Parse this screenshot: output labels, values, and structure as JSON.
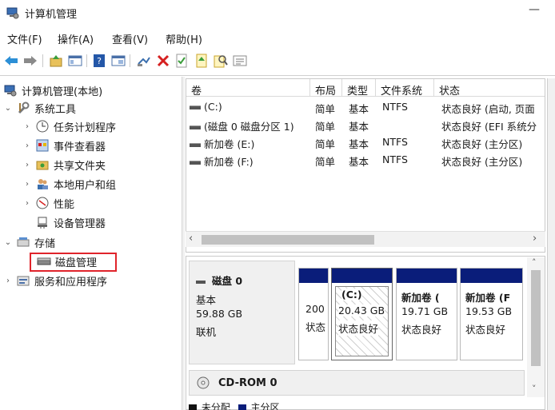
{
  "window": {
    "title": "计算机管理",
    "minimize_glyph": "—"
  },
  "menu": [
    {
      "label": "文件(F)"
    },
    {
      "label": "操作(A)"
    },
    {
      "label": "查看(V)"
    },
    {
      "label": "帮助(H)"
    }
  ],
  "toolbar": {
    "icons": [
      "back-arrow-icon",
      "forward-arrow-icon",
      "up-folder-icon",
      "show-tree-icon",
      "help-icon",
      "console-icon",
      "connect-icon",
      "delete-icon",
      "properties-icon",
      "import-icon",
      "search-icon",
      "settings-list-icon"
    ]
  },
  "tree": {
    "root": "计算机管理(本地)",
    "system_tools": "系统工具",
    "task_scheduler": "任务计划程序",
    "event_viewer": "事件查看器",
    "shared_folders": "共享文件夹",
    "local_users": "本地用户和组",
    "performance": "性能",
    "device_manager": "设备管理器",
    "storage": "存储",
    "disk_management": "磁盘管理",
    "services_apps": "服务和应用程序"
  },
  "volume_table": {
    "columns": [
      "卷",
      "布局",
      "类型",
      "文件系统",
      "状态"
    ],
    "rows": [
      {
        "volume": "(C:)",
        "layout": "简单",
        "type": "基本",
        "fs": "NTFS",
        "status": "状态良好 (启动, 页面"
      },
      {
        "volume": "(磁盘 0 磁盘分区 1)",
        "layout": "简单",
        "type": "基本",
        "fs": "",
        "status": "状态良好 (EFI 系统分"
      },
      {
        "volume": "新加卷 (E:)",
        "layout": "简单",
        "type": "基本",
        "fs": "NTFS",
        "status": "状态良好 (主分区)"
      },
      {
        "volume": "新加卷 (F:)",
        "layout": "简单",
        "type": "基本",
        "fs": "NTFS",
        "status": "状态良好 (主分区)"
      }
    ]
  },
  "disk0": {
    "name": "磁盘 0",
    "type": "基本",
    "size": "59.88 GB",
    "state": "联机",
    "partitions": [
      {
        "line1": "",
        "line2": "200",
        "line3": "状态"
      },
      {
        "line1": "(C:)",
        "line2": "20.43 GB",
        "line3": "状态良好"
      },
      {
        "line1": "新加卷 (",
        "line2": "19.71 GB",
        "line3": "状态良好"
      },
      {
        "line1": "新加卷 (F",
        "line2": "19.53 GB",
        "line3": "状态良好"
      }
    ]
  },
  "cdrom": {
    "name": "CD-ROM 0"
  },
  "legend": {
    "unallocated": "未分配",
    "primary": "主分区"
  },
  "colors": {
    "partition_bar": "#0a1d7a",
    "highlight": "#e0242b"
  }
}
